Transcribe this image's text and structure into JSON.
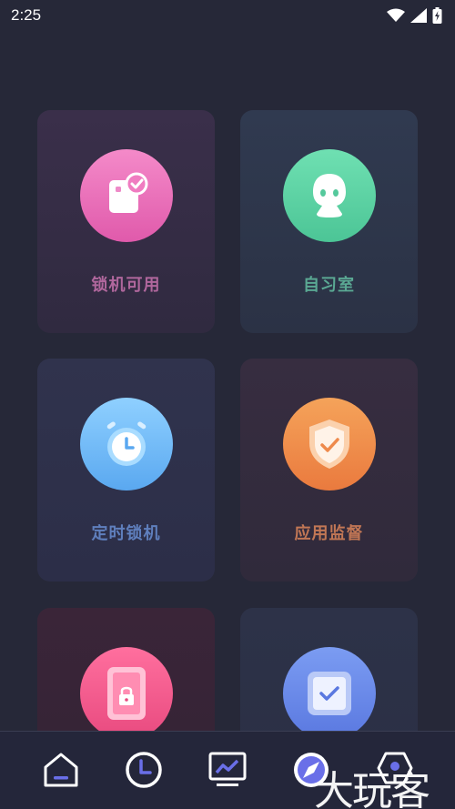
{
  "status_bar": {
    "time": "2:25",
    "icons": [
      "wifi-icon",
      "signal-icon",
      "battery-charging-icon"
    ]
  },
  "cards": [
    {
      "id": "lock-usable",
      "label": "锁机可用",
      "icon": "phone-check-icon",
      "label_color": "#b0679d"
    },
    {
      "id": "study-room",
      "label": "自习室",
      "icon": "robot-icon",
      "label_color": "#5aa893"
    },
    {
      "id": "timed-lock",
      "label": "定时锁机",
      "icon": "alarm-clock-icon",
      "label_color": "#5f7fbd"
    },
    {
      "id": "app-monitor",
      "label": "应用监督",
      "icon": "shield-check-icon",
      "label_color": "#c27755"
    },
    {
      "id": "row3-left",
      "label": "",
      "icon": "phone-lock-icon",
      "label_color": "#c05a80"
    },
    {
      "id": "row3-right",
      "label": "",
      "icon": "checkbox-icon",
      "label_color": "#6f86d8"
    }
  ],
  "bottom_nav": {
    "items": [
      {
        "id": "home",
        "icon": "home-icon"
      },
      {
        "id": "clock",
        "icon": "clock-icon"
      },
      {
        "id": "stats",
        "icon": "chart-monitor-icon"
      },
      {
        "id": "discover",
        "icon": "compass-icon"
      },
      {
        "id": "profile",
        "icon": "user-icon"
      }
    ]
  },
  "watermark": "大玩客"
}
